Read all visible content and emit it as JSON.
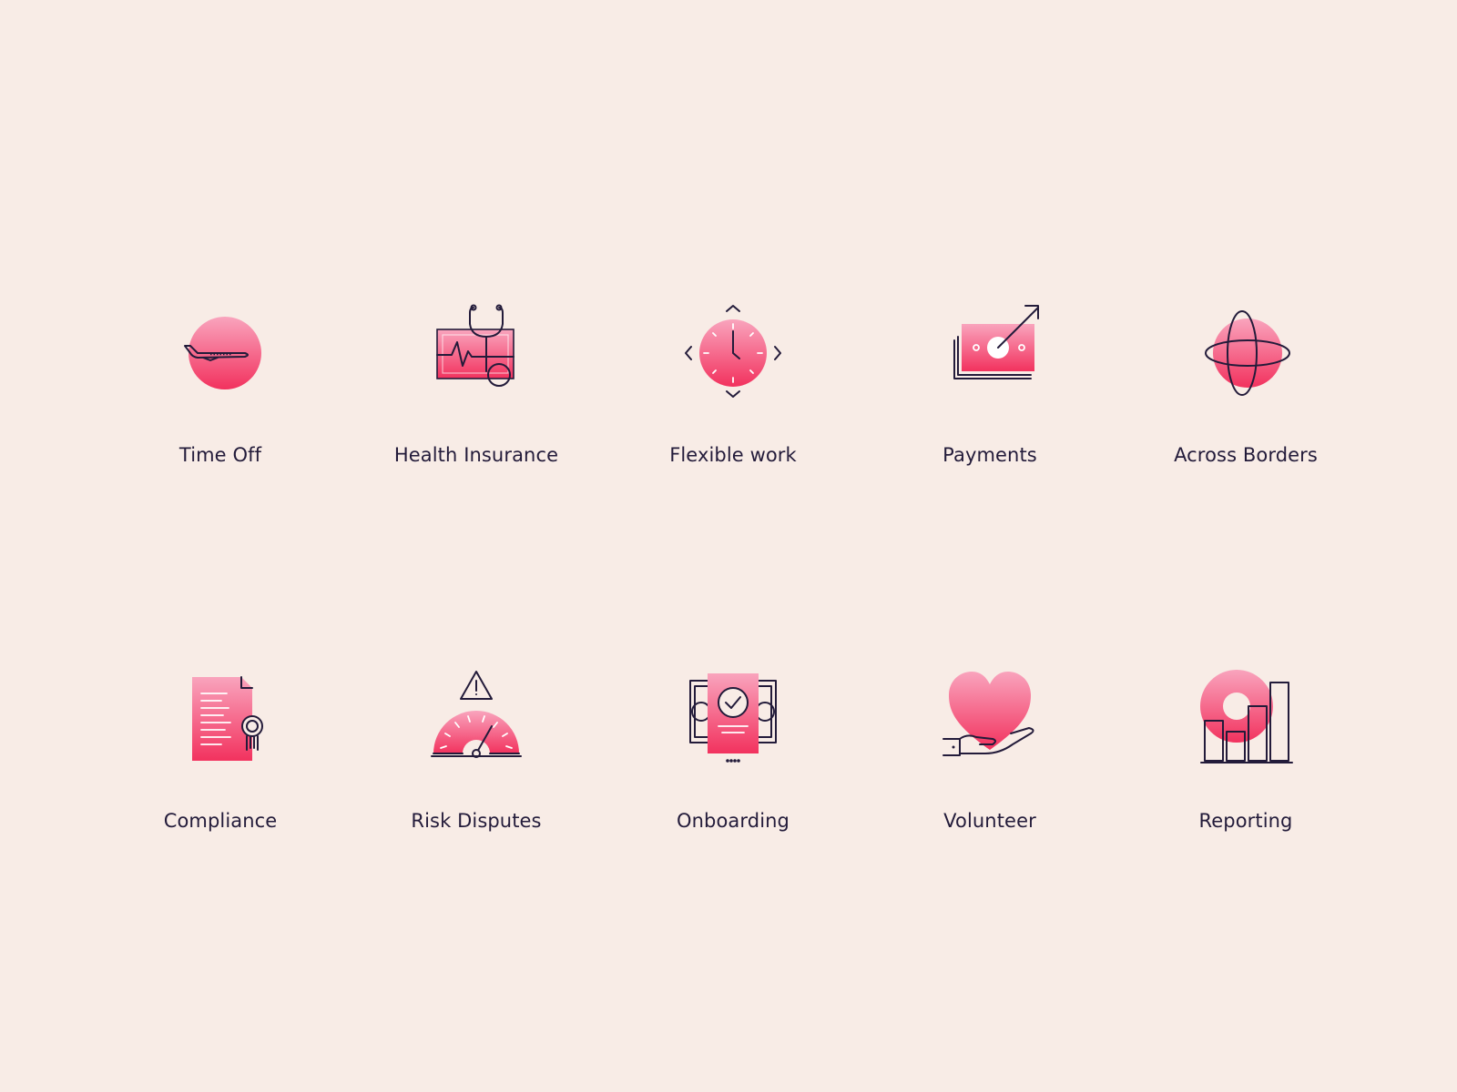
{
  "colors": {
    "background": "#F8ECE6",
    "text": "#231B3A",
    "gradient_top": "#F9A4BD",
    "gradient_bottom": "#F2325E",
    "outline": "#231B3A"
  },
  "icons": [
    {
      "icon": "airplane-globe-icon",
      "label": "Time Off"
    },
    {
      "icon": "stethoscope-heartbeat-icon",
      "label": "Health Insurance"
    },
    {
      "icon": "clock-arrows-icon",
      "label": "Flexible work"
    },
    {
      "icon": "money-growth-icon",
      "label": "Payments"
    },
    {
      "icon": "orbit-globe-icon",
      "label": "Across Borders"
    },
    {
      "icon": "certificate-document-icon",
      "label": "Compliance"
    },
    {
      "icon": "gauge-warning-icon",
      "label": "Risk Disputes"
    },
    {
      "icon": "approval-document-icon",
      "label": "Onboarding"
    },
    {
      "icon": "heart-hand-icon",
      "label": "Volunteer"
    },
    {
      "icon": "donut-bar-chart-icon",
      "label": "Reporting"
    }
  ]
}
